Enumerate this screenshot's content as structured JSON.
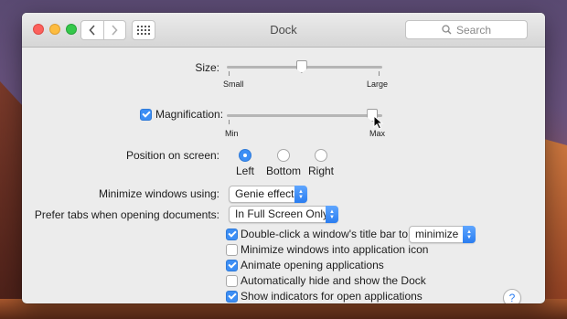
{
  "window": {
    "title": "Dock",
    "search_placeholder": "Search"
  },
  "size": {
    "label": "Size:",
    "min_label": "Small",
    "max_label": "Large",
    "value_fraction": 0.48
  },
  "magnification": {
    "label": "Magnification:",
    "checked": true,
    "min_label": "Min",
    "max_label": "Max",
    "value_fraction": 0.97
  },
  "position": {
    "label": "Position on screen:",
    "options": [
      "Left",
      "Bottom",
      "Right"
    ],
    "selected": "Left"
  },
  "minimize": {
    "label": "Minimize windows using:",
    "value": "Genie effect"
  },
  "tabs": {
    "label": "Prefer tabs when opening documents:",
    "value": "In Full Screen Only"
  },
  "checkboxes": [
    {
      "label": "Double-click a window's title bar to",
      "checked": true
    },
    {
      "label": "Minimize windows into application icon",
      "checked": false
    },
    {
      "label": "Animate opening applications",
      "checked": true
    },
    {
      "label": "Automatically hide and show the Dock",
      "checked": false
    },
    {
      "label": "Show indicators for open applications",
      "checked": true
    }
  ],
  "double_click_action": "minimize",
  "help_label": "?",
  "colors": {
    "accent": "#3c8ef5"
  }
}
